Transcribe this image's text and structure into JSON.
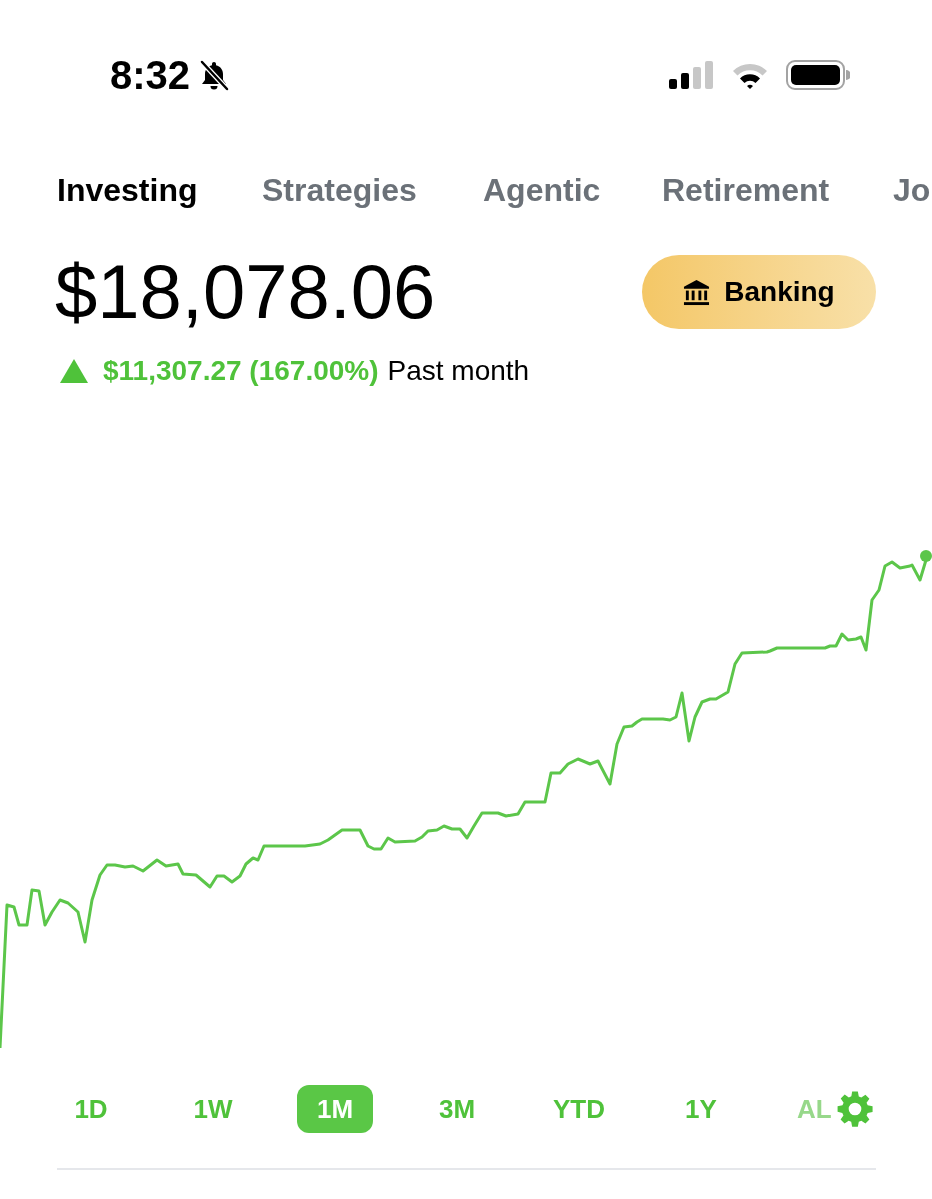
{
  "status_bar": {
    "time": "8:32",
    "silent": true
  },
  "tabs": [
    {
      "label": "Investing",
      "selected": true
    },
    {
      "label": "Strategies",
      "selected": false
    },
    {
      "label": "Agentic",
      "selected": false
    },
    {
      "label": "Retirement",
      "selected": false
    },
    {
      "label": "Jo",
      "selected": false
    }
  ],
  "balance": "$18,078.06",
  "banking_button": {
    "label": "Banking"
  },
  "change": {
    "positive": true,
    "amount": "$11,307.27 (167.00%)",
    "period": "Past month"
  },
  "range_tabs": [
    {
      "label": "1D",
      "selected": false,
      "faded": false
    },
    {
      "label": "1W",
      "selected": false,
      "faded": false
    },
    {
      "label": "1M",
      "selected": true,
      "faded": false
    },
    {
      "label": "3M",
      "selected": false,
      "faded": false
    },
    {
      "label": "YTD",
      "selected": false,
      "faded": false
    },
    {
      "label": "1Y",
      "selected": false,
      "faded": false
    },
    {
      "label": "AL",
      "selected": false,
      "faded": true
    }
  ]
}
